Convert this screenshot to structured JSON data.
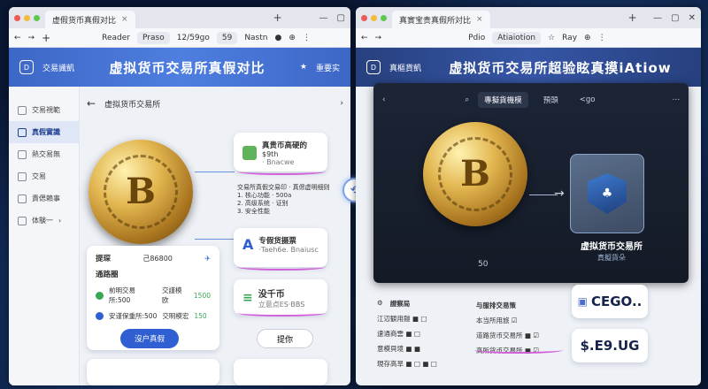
{
  "left": {
    "tab_title": "虚假货币真假对比",
    "address": {
      "reader": "Reader",
      "p1": "Praso",
      "p2": "12/59go",
      "p3": "59",
      "p4": "Nastn"
    },
    "header": {
      "badge": "交易識凱",
      "title": "虚拟货币交易所真假对比",
      "right": "重要实"
    },
    "sidebar": [
      {
        "label": "交易視範"
      },
      {
        "label": "真假實識"
      },
      {
        "label": "熱交易無"
      },
      {
        "label": "交易"
      },
      {
        "label": "責偲賴事"
      },
      {
        "label": "体験一"
      }
    ],
    "crumb": "虚拟货币交易所",
    "card1": {
      "title": "真贵币高硬的",
      "sub": "$9th",
      "sub2": "· Bnacwe"
    },
    "card_mid": {
      "l1": "交易所真假交易印 · 真偲虚明细则",
      "l2": "1. 核心功能 · 500a",
      "l3": "2. 高级系统 · 证别",
      "l4": "3. 安全性能"
    },
    "card2": {
      "title": "专假货摄票",
      "sub": "·Taeh6e. Bnaiusc"
    },
    "card3": {
      "title": "没千币",
      "sub": "立意点ES·BBS"
    },
    "compare": {
      "label1": "提琛",
      "value1": "己86800",
      "label2": "通路圈",
      "rows": [
        {
          "name": "前明交易所:500",
          "mid": "交謹模欧",
          "val": "1500"
        },
        {
          "name": "安谨保重所:500",
          "mid": "交明模宏",
          "val": "150"
        }
      ],
      "button": "沒户真假"
    },
    "bottom_pill": "提你"
  },
  "right": {
    "tab_title": "真實宝贵真假所対比",
    "address": {
      "reader": "Pdio",
      "p1": "Atiaiotion",
      "p2": "Ray"
    },
    "header": {
      "badge": "真樞貨凱",
      "title": "虚拟货币交易所超验眩真摸iAtiow"
    },
    "panel": {
      "tab1": "專擬貨機模",
      "tab2": "預頭",
      "tab3": "<go",
      "caption": "虚拟货币交易所",
      "sub": "真擬貨朵",
      "num": "50"
    },
    "info": {
      "title": "證察局",
      "rows": [
        "江辺観用鎧  ■  □",
        "速通商雲  ■  □",
        "意模貝境  ■  ■",
        "現存高旱  ■ □ ■ □"
      ]
    },
    "info2": {
      "title": "与服排交易策",
      "rows": [
        "本当所用旅    ☑",
        "道路货币交易所 ■ ☑",
        "高所货币交易所 ■ ☑"
      ]
    },
    "price1": "CEGO..",
    "price2": "$.E9.UG"
  },
  "colors": {
    "accent": "#3d67c7",
    "coin": "#d9a94a",
    "pink_curve": "#d25fd9"
  }
}
